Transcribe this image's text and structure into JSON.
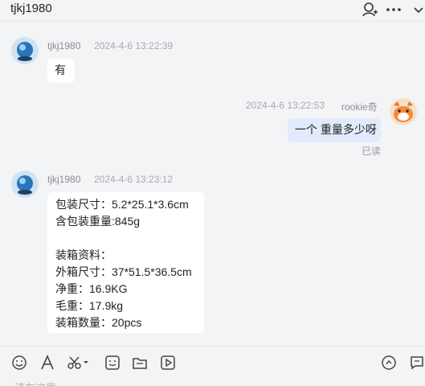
{
  "header": {
    "title": "tjkj1980"
  },
  "messages": [
    {
      "sender": "tjkj1980",
      "time": "2024-4-6 13:22:39",
      "lines": [
        "有"
      ],
      "avatar": "globe-avatar"
    },
    {
      "sender": "rookie奇",
      "time": "2024-4-6 13:22:53",
      "lines": [
        "一个 重量多少呀"
      ],
      "status": "已读",
      "avatar": "cartoon-avatar"
    },
    {
      "sender": "tjkj1980",
      "time": "2024-4-6 13:23:12",
      "lines": [
        "包装尺寸：5.2*25.1*3.6cm",
        "含包装重量:845g",
        "",
        "装箱资料：",
        "外箱尺寸：37*51.5*36.5cm",
        "净重：16.9KG",
        "毛重：17.9kg",
        "装箱数量：20pcs"
      ],
      "avatar": "globe-avatar"
    }
  ],
  "toolbar": {
    "icons": [
      "emoji-icon",
      "font-icon",
      "scissors-icon",
      "sticker-icon",
      "folder-icon",
      "video-icon",
      "quick-reply-icon",
      "chat-history-icon"
    ]
  },
  "input": {
    "hint": "请在这里..."
  },
  "colors": {
    "background": "#f3f4f6",
    "my_bubble": "#e2ebfb",
    "other_bubble": "#ffffff"
  }
}
